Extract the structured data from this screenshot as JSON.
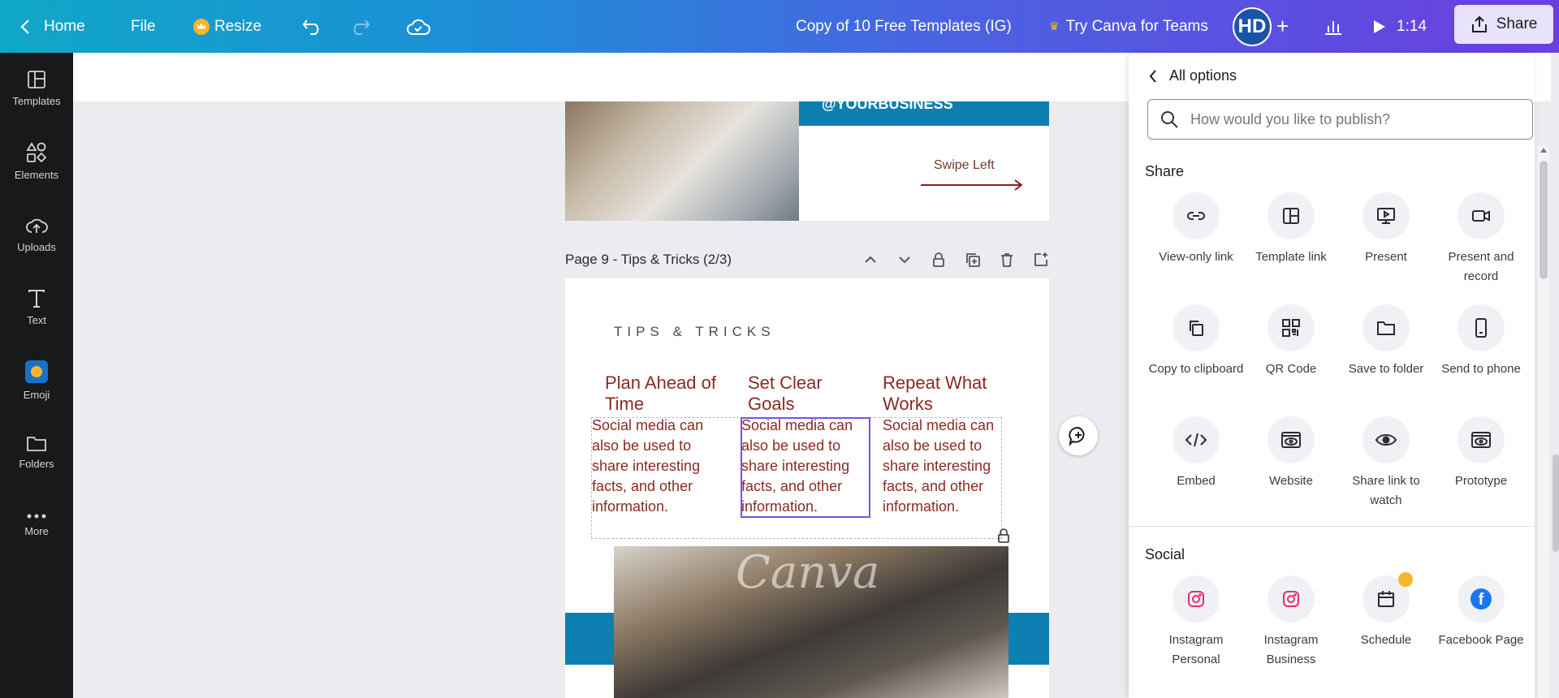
{
  "topbar": {
    "home": "Home",
    "file": "File",
    "resize": "Resize",
    "doc_title": "Copy of 10 Free Templates (IG)",
    "try_teams": "Try Canva for Teams",
    "avatar_initials": "HD",
    "timer": "1:14",
    "share": "Share"
  },
  "rail": {
    "items": [
      {
        "label": "Templates",
        "icon": "templates-icon"
      },
      {
        "label": "Elements",
        "icon": "elements-icon"
      },
      {
        "label": "Uploads",
        "icon": "upload-icon"
      },
      {
        "label": "Text",
        "icon": "text-icon"
      },
      {
        "label": "Emoji",
        "icon": "emoji-icon"
      },
      {
        "label": "Folders",
        "icon": "folder-icon"
      },
      {
        "label": "More",
        "icon": "more-icon"
      }
    ]
  },
  "canvas": {
    "page8_handle": "@YOURBUSINESS",
    "swipe_label": "Swipe Left",
    "page9_title": "Page 9 - Tips & Tricks (2/3)",
    "tips_heading": "TIPS & TRICKS",
    "columns": [
      {
        "title": "Plan Ahead of Time",
        "body": "Social media can also be used to share interesting facts, and other information."
      },
      {
        "title": "Set Clear Goals",
        "body": "Social media can also be used to share interesting facts, and other information."
      },
      {
        "title": "Repeat What Works",
        "body": "Social media can also be used to share interesting facts, and other information."
      }
    ],
    "watermark": "Canva"
  },
  "panel": {
    "back_label": "All options",
    "search_placeholder": "How would you like to publish?",
    "share_section": "Share",
    "share_options": [
      {
        "label": "View-only link",
        "icon": "link-icon"
      },
      {
        "label": "Template link",
        "icon": "template-icon"
      },
      {
        "label": "Present",
        "icon": "present-icon"
      },
      {
        "label": "Present and record",
        "icon": "video-camera-icon"
      },
      {
        "label": "Copy to clipboard",
        "icon": "copy-icon"
      },
      {
        "label": "QR Code",
        "icon": "qr-code-icon"
      },
      {
        "label": "Save to folder",
        "icon": "folder-icon"
      },
      {
        "label": "Send to phone",
        "icon": "phone-icon"
      },
      {
        "label": "Embed",
        "icon": "embed-icon"
      },
      {
        "label": "Website",
        "icon": "website-icon"
      },
      {
        "label": "Share link to watch",
        "icon": "eye-icon"
      },
      {
        "label": "Prototype",
        "icon": "prototype-icon"
      }
    ],
    "social_section": "Social",
    "social_options": [
      {
        "label": "Instagram Personal",
        "icon": "instagram-icon"
      },
      {
        "label": "Instagram Business",
        "icon": "instagram-icon"
      },
      {
        "label": "Schedule",
        "icon": "calendar-icon"
      },
      {
        "label": "Facebook Page",
        "icon": "facebook-icon"
      }
    ]
  },
  "colors": {
    "accent_purple": "#7d4fe0",
    "brand_blue": "#0d7fb0",
    "text_maroon": "#8a2a22",
    "crown_gold": "#f7b628"
  }
}
